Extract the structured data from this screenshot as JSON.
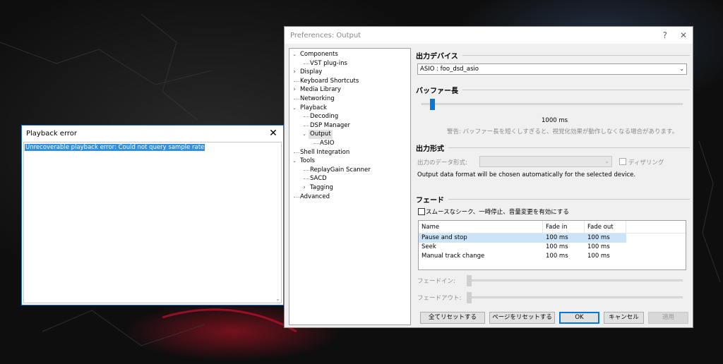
{
  "error_window": {
    "title": "Playback error",
    "message": "Unrecoverable playback error: Could not query sample rate"
  },
  "preferences": {
    "title": "Preferences: Output",
    "help_glyph": "?",
    "close_glyph": "✕",
    "tree": [
      {
        "label": "Components",
        "level": 0,
        "expander": "open"
      },
      {
        "label": "VST plug-ins",
        "level": 1,
        "expander": "none"
      },
      {
        "label": "Display",
        "level": 0,
        "expander": "closed"
      },
      {
        "label": "Keyboard Shortcuts",
        "level": 0,
        "expander": "none"
      },
      {
        "label": "Media Library",
        "level": 0,
        "expander": "closed"
      },
      {
        "label": "Networking",
        "level": 0,
        "expander": "none"
      },
      {
        "label": "Playback",
        "level": 0,
        "expander": "open"
      },
      {
        "label": "Decoding",
        "level": 1,
        "expander": "none"
      },
      {
        "label": "DSP Manager",
        "level": 1,
        "expander": "none"
      },
      {
        "label": "Output",
        "level": 1,
        "expander": "open",
        "selected": true
      },
      {
        "label": "ASIO",
        "level": 2,
        "expander": "none"
      },
      {
        "label": "Shell Integration",
        "level": 0,
        "expander": "none"
      },
      {
        "label": "Tools",
        "level": 0,
        "expander": "open"
      },
      {
        "label": "ReplayGain Scanner",
        "level": 1,
        "expander": "none"
      },
      {
        "label": "SACD",
        "level": 1,
        "expander": "none"
      },
      {
        "label": "Tagging",
        "level": 1,
        "expander": "closed"
      },
      {
        "label": "Advanced",
        "level": 0,
        "expander": "none"
      }
    ],
    "device": {
      "heading": "出力デバイス",
      "selected": "ASIO : foo_dsd_asio"
    },
    "buffer": {
      "heading": "バッファー長",
      "value_label": "1000 ms",
      "warning": "警告: バッファー長を短くしすぎると、視覚化効果が動作しなくなる場合があります。",
      "slider_fraction": 0.04
    },
    "format": {
      "heading": "出力形式",
      "label": "出力のデータ形式:",
      "selected": "",
      "dither_label": "ディザリング",
      "note": "Output data format will be chosen automatically for the selected device."
    },
    "fade": {
      "heading": "フェード",
      "smooth_label": "スムースなシーク、一時停止、音量変更を有効にする",
      "columns": [
        "Name",
        "Fade in",
        "Fade out"
      ],
      "rows": [
        [
          "Pause and stop",
          "100 ms",
          "100 ms"
        ],
        [
          "Seek",
          "100 ms",
          "100 ms"
        ],
        [
          "Manual track change",
          "100 ms",
          "100 ms"
        ]
      ],
      "fade_in_label": "フェードイン:",
      "fade_out_label": "フェードアウト:"
    },
    "buttons": {
      "reset_all": "全てリセットする",
      "reset_page": "ページをリセットする",
      "ok": "OK",
      "cancel": "キャンセル",
      "apply": "適用"
    },
    "colors": {
      "accent": "#0078d7",
      "selection": "#3390e0",
      "list_selection": "#cce4f7"
    }
  }
}
